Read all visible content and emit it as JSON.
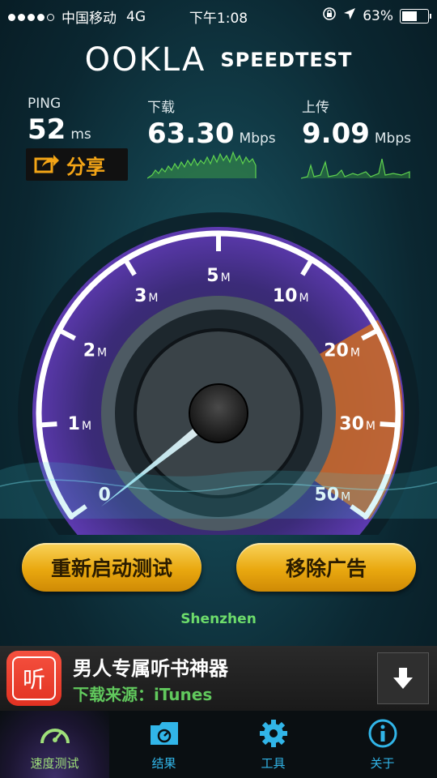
{
  "status_bar": {
    "carrier": "中国移动",
    "network": "4G",
    "time": "下午1:08",
    "battery_text": "63%",
    "battery_level": 0.63
  },
  "brand": {
    "logo": "OOKLA",
    "product": "SPEEDTEST"
  },
  "results": {
    "ping": {
      "label": "PING",
      "value": "52",
      "unit": "ms"
    },
    "download": {
      "label": "下载",
      "value": "63.30",
      "unit": "Mbps"
    },
    "upload": {
      "label": "上传",
      "value": "9.09",
      "unit": "Mbps"
    }
  },
  "share_button": {
    "label": "分享",
    "icon": "share-arrow-icon"
  },
  "gauge": {
    "ticks": [
      {
        "num": "0",
        "unit": ""
      },
      {
        "num": "1",
        "unit": "M"
      },
      {
        "num": "2",
        "unit": "M"
      },
      {
        "num": "3",
        "unit": "M"
      },
      {
        "num": "5",
        "unit": "M"
      },
      {
        "num": "10",
        "unit": "M"
      },
      {
        "num": "20",
        "unit": "M"
      },
      {
        "num": "30",
        "unit": "M"
      },
      {
        "num": "50",
        "unit": "M"
      }
    ],
    "needle_value": 0
  },
  "buttons": {
    "restart": "重新启动测试",
    "remove_ads": "移除广告"
  },
  "location": "Shenzhen",
  "ad": {
    "icon_char": "听",
    "title": "男人专属听书神器",
    "source": "下载来源：iTunes"
  },
  "tabs": [
    {
      "label": "速度测试",
      "icon": "speedometer-icon",
      "active": true
    },
    {
      "label": "结果",
      "icon": "results-folder-icon",
      "active": false
    },
    {
      "label": "工具",
      "icon": "gear-icon",
      "active": false
    },
    {
      "label": "关于",
      "icon": "info-icon",
      "active": false
    }
  ],
  "colors": {
    "accent_gold": "#f4a516",
    "tab_blue": "#31b5e8",
    "location_green": "#6ddc6b",
    "gauge_purple": "#4b2f8f",
    "gauge_orange": "#e07a2a"
  }
}
